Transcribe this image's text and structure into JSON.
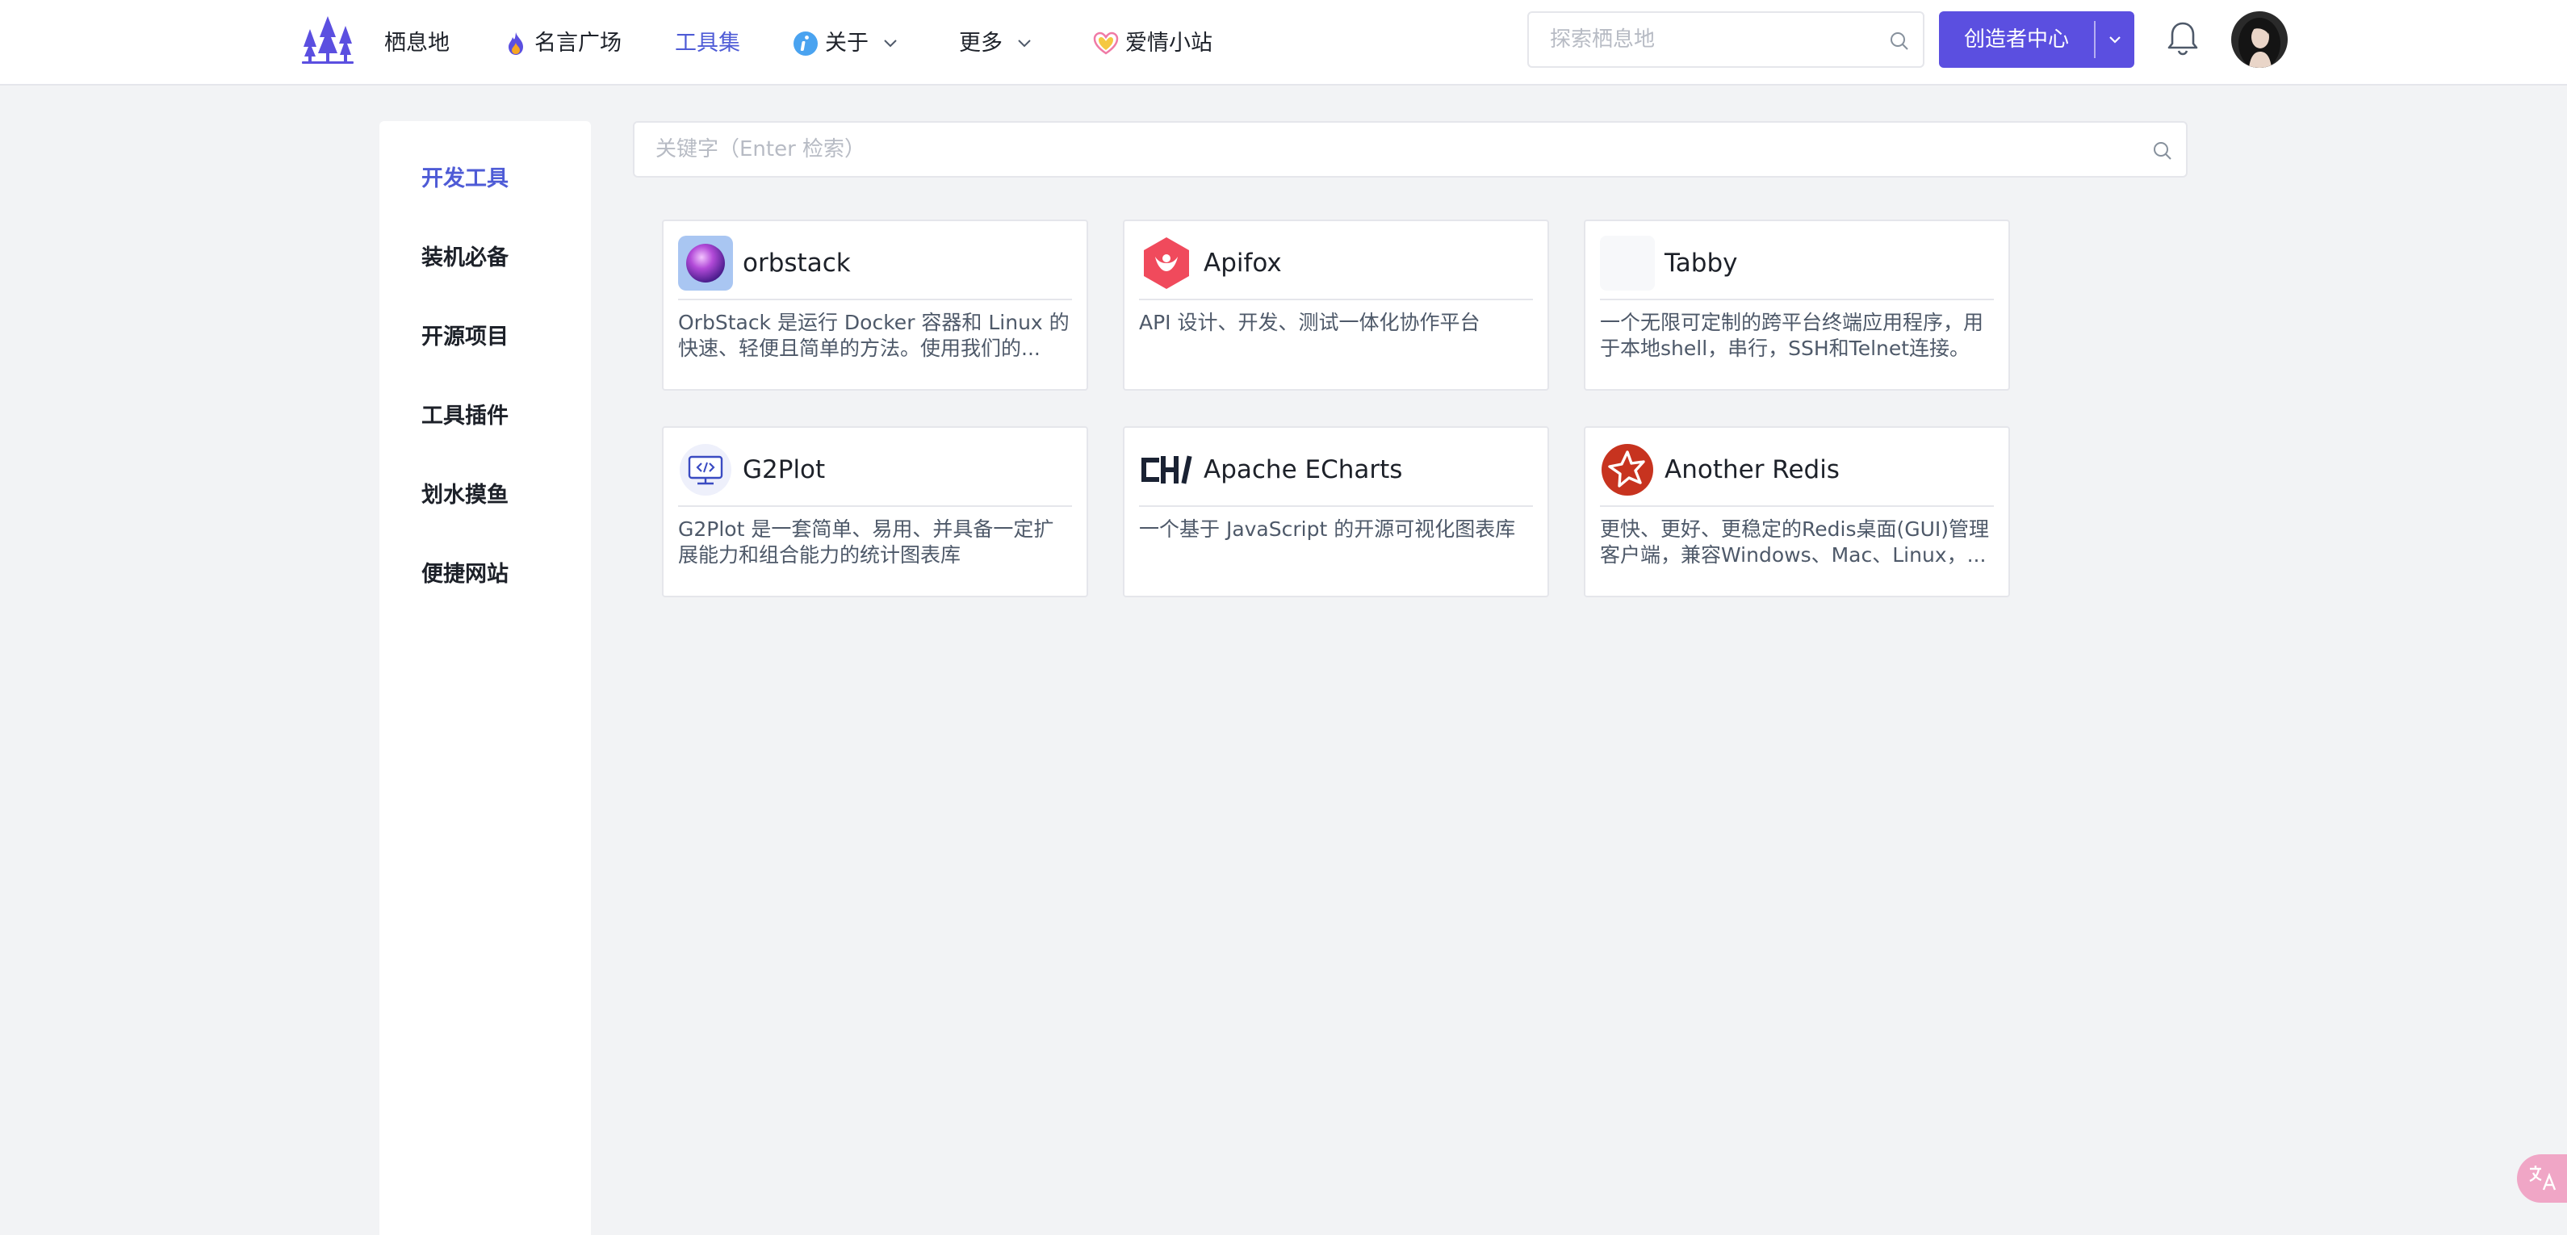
{
  "header": {
    "nav": [
      {
        "label": "栖息地"
      },
      {
        "label": "名言广场"
      },
      {
        "label": "工具集"
      },
      {
        "label": "关于"
      },
      {
        "label": "更多"
      },
      {
        "label": "爱情小站"
      }
    ],
    "active_nav": "工具集",
    "search": {
      "placeholder": "探索栖息地",
      "value": ""
    },
    "creator_button": "创造者中心"
  },
  "sidebar": {
    "items": [
      {
        "label": "开发工具",
        "active": true
      },
      {
        "label": "装机必备",
        "active": false
      },
      {
        "label": "开源项目",
        "active": false
      },
      {
        "label": "工具插件",
        "active": false
      },
      {
        "label": "划水摸鱼",
        "active": false
      },
      {
        "label": "便捷网站",
        "active": false
      }
    ]
  },
  "main": {
    "search": {
      "placeholder": "关键字（Enter 检索）",
      "value": ""
    },
    "tools": [
      {
        "name": "orbstack",
        "icon": "orbstack-icon",
        "desc": "OrbStack 是运行 Docker 容器和 Linux 的快速、轻便且简单的方法。使用我们的..."
      },
      {
        "name": "Apifox",
        "icon": "apifox-icon",
        "desc": "API 设计、开发、测试一体化协作平台"
      },
      {
        "name": "Tabby",
        "icon": "tabby-icon",
        "desc": "一个无限可定制的跨平台终端应用程序，用于本地shell，串行，SSH和Telnet连接。"
      },
      {
        "name": "G2Plot",
        "icon": "g2plot-icon",
        "desc": "G2Plot 是一套简单、易用、并具备一定扩展能力和组合能力的统计图表库"
      },
      {
        "name": "Apache ECharts",
        "icon": "echarts-icon",
        "desc": "一个基于 JavaScript 的开源可视化图表库"
      },
      {
        "name": "Another Redis",
        "icon": "another-redis-icon",
        "desc": "更快、更好、更稳定的Redis桌面(GUI)管理客户端，兼容Windows、Mac、Linux，..."
      }
    ]
  },
  "colors": {
    "accent": "#4e5bd6",
    "primary_button": "#5b4fe0",
    "background": "#f2f3f5"
  }
}
